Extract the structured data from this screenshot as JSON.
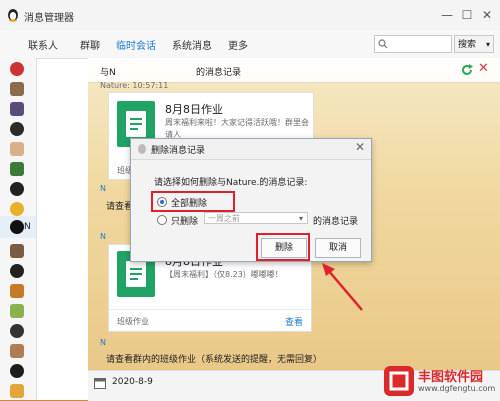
{
  "window": {
    "title": "消息管理器"
  },
  "tabs": [
    "联系人",
    "群聊",
    "临时会话",
    "系统消息",
    "更多"
  ],
  "active_tab": "临时会话",
  "search": {
    "button_label": "搜索"
  },
  "sidebar": {
    "selected_contact": "N"
  },
  "chat_header": {
    "with_prefix": "与N",
    "records_suffix": "的消息记录"
  },
  "hint_line": "Nature: 10:57:11",
  "card1": {
    "title": "8月8日作业",
    "subtitle": "周末福利来啦！大家记得活跃哦！群里会请人",
    "label": "班级作业"
  },
  "messages": [
    {
      "sender": "N",
      "text": "请查看群内的班级作业"
    },
    {
      "sender": "N"
    }
  ],
  "card2": {
    "title": "8月8日作业",
    "subtitle": "【周末福利】（仅8.23）嘟嘟嘟！",
    "label": "班级作业",
    "link": "查看"
  },
  "message3": {
    "sender": "N",
    "text": "请查看群内的班级作业（系统发送的提醒，无需回复）"
  },
  "dialog": {
    "title": "删除消息记录",
    "question": "请选择如何删除与Nature.的消息记录:",
    "option_all": "全部删除",
    "option_only": "只删除",
    "select_value": "一周之前",
    "option_suffix": "的消息记录",
    "delete_button": "删除",
    "cancel_button": "取消"
  },
  "bottom": {
    "date": "2020-8-9"
  },
  "watermark": {
    "name": "丰图软件园",
    "url": "www.dgfengtu.com"
  },
  "colors": {
    "accent": "#1f7ad6",
    "highlight": "#e0212c",
    "doc_green": "#21a366"
  }
}
